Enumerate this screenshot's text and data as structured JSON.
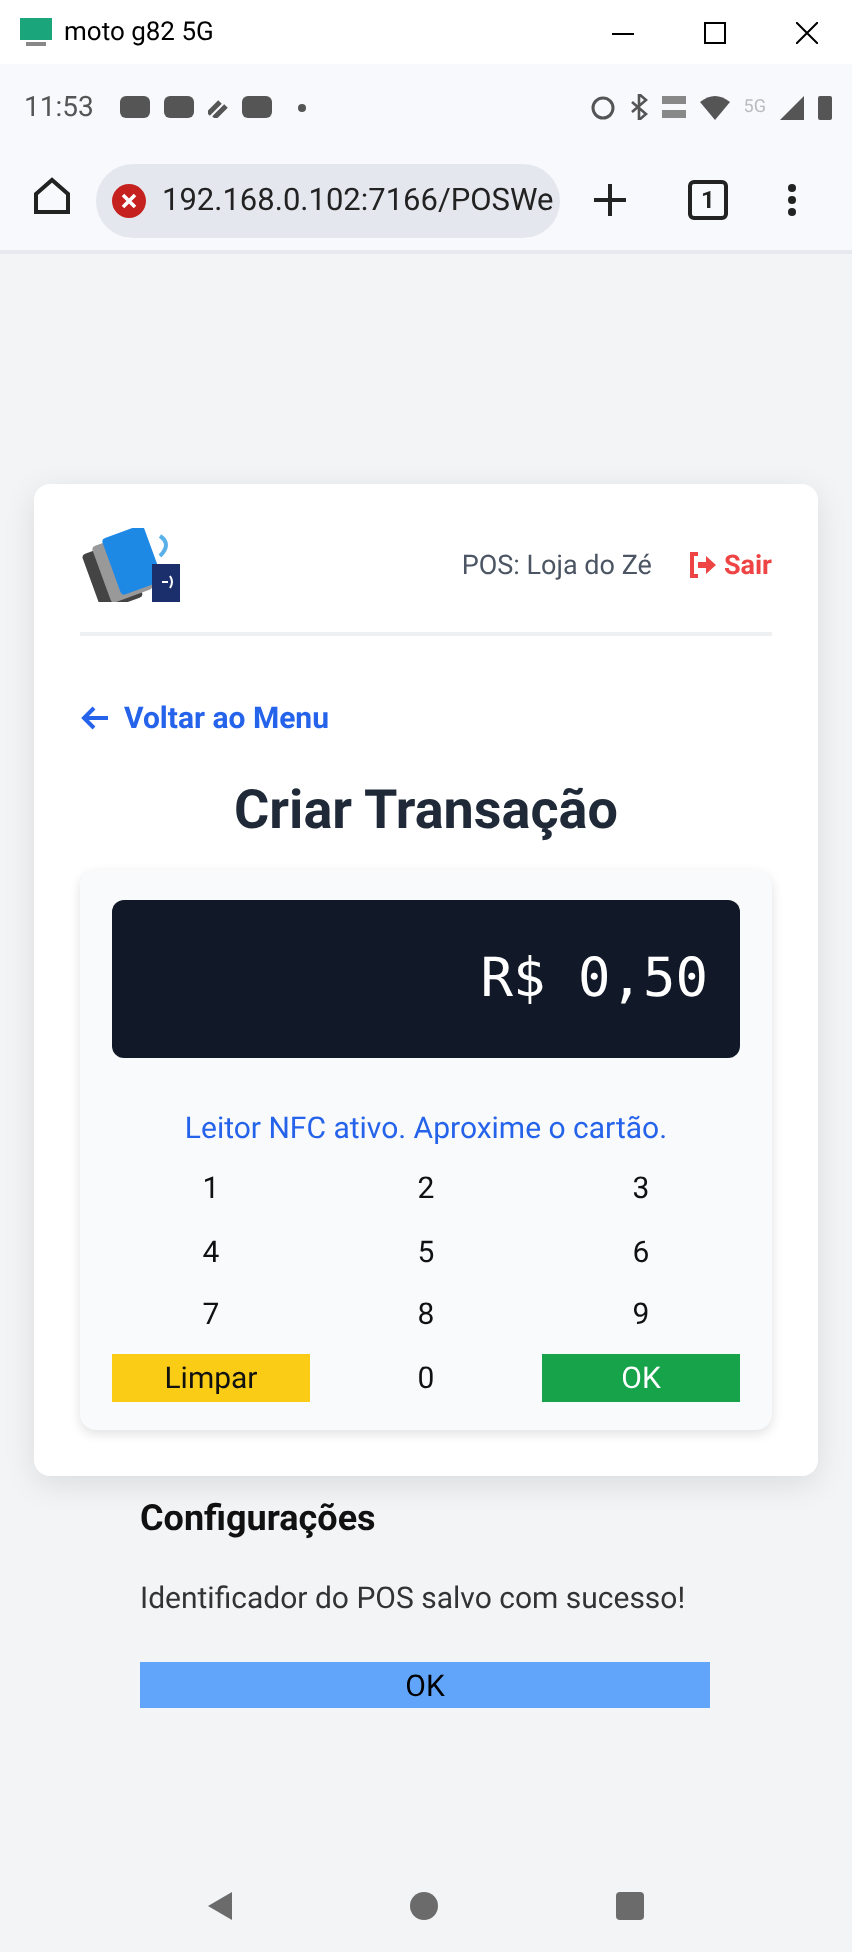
{
  "window": {
    "title": "moto g82 5G"
  },
  "status_bar": {
    "time": "11:53",
    "network_label": "5G"
  },
  "browser": {
    "url": "192.168.0.102:7166/POSWe",
    "tab_count": "1"
  },
  "header": {
    "pos_label": "POS: Loja do Zé",
    "logout": "Sair"
  },
  "back_link": "Voltar ao Menu",
  "title": "Criar Transação",
  "amount": "R$ 0,50",
  "nfc_status": "Leitor NFC ativo. Aproxime o cartão.",
  "keys": [
    {
      "label": "1",
      "kind": "digit"
    },
    {
      "label": "2",
      "kind": "digit"
    },
    {
      "label": "3",
      "kind": "digit"
    },
    {
      "label": "4",
      "kind": "digit"
    },
    {
      "label": "5",
      "kind": "digit"
    },
    {
      "label": "6",
      "kind": "digit"
    },
    {
      "label": "7",
      "kind": "digit"
    },
    {
      "label": "8",
      "kind": "digit"
    },
    {
      "label": "9",
      "kind": "digit"
    },
    {
      "label": "Limpar",
      "kind": "clear"
    },
    {
      "label": "0",
      "kind": "digit"
    },
    {
      "label": "OK",
      "kind": "confirm"
    }
  ],
  "background_dialog": {
    "title": "Configurações",
    "message": "Identificador do POS salvo com sucesso!",
    "button": "OK"
  }
}
